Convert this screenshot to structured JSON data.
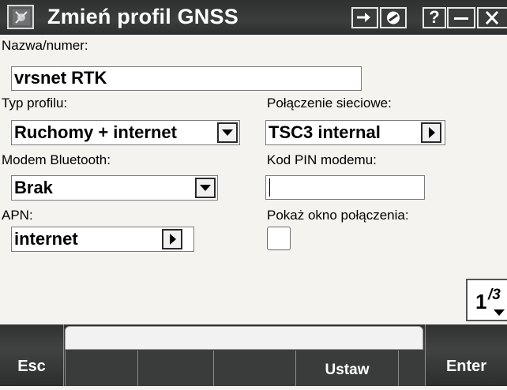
{
  "window": {
    "title": "Zmień profil GNSS",
    "help_label": "?",
    "minimize_label": "–",
    "close_label": "×"
  },
  "form": {
    "name": {
      "label": "Nazwa/numer:",
      "value": "vrsnet RTK"
    },
    "profile_type": {
      "label": "Typ profilu:",
      "value": "Ruchomy + internet"
    },
    "network_connection": {
      "label": "Połączenie sieciowe:",
      "value": "TSC3 internal"
    },
    "bluetooth_modem": {
      "label": "Modem Bluetooth:",
      "value": "Brak"
    },
    "modem_pin": {
      "label": "Kod PIN modemu:",
      "value": ""
    },
    "apn": {
      "label": "APN:",
      "value": "internet"
    },
    "show_connection_window": {
      "label": "Pokaż okno połączenia:",
      "checked": false
    }
  },
  "pager": {
    "current": "1",
    "total": "/3"
  },
  "softkeys": {
    "esc": "Esc",
    "enter": "Enter",
    "middle": [
      "",
      "",
      "",
      "Ustaw",
      ""
    ]
  }
}
